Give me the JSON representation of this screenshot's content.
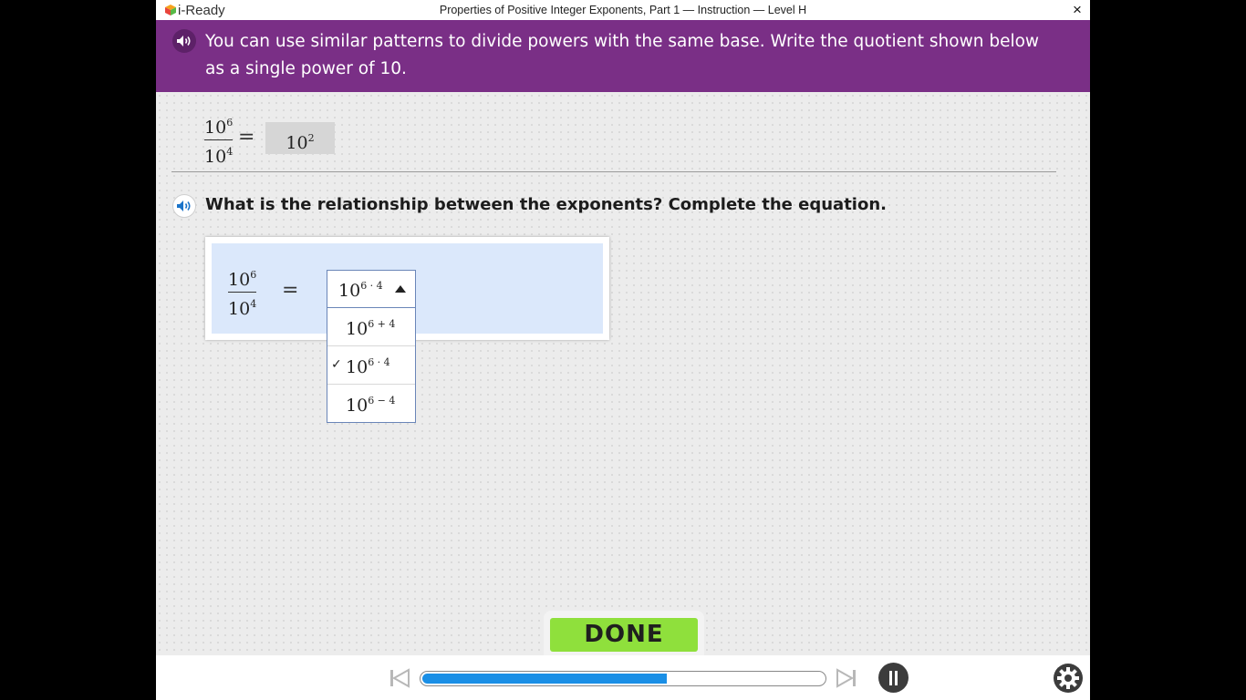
{
  "window": {
    "brand": "i-Ready",
    "title": "Properties of Positive Integer Exponents, Part 1 — Instruction — Level H",
    "close_label": "×"
  },
  "banner": {
    "text": "You can use similar patterns to divide powers with the same base. Write the quotient shown below as a single power of 10."
  },
  "example": {
    "num_base": "10",
    "num_exp": "6",
    "den_base": "10",
    "den_exp": "4",
    "equals": "=",
    "answer_base": "10",
    "answer_exp": "2"
  },
  "question": {
    "text": "What is the relationship between the exponents? Complete the equation."
  },
  "equation": {
    "num_base": "10",
    "num_exp": "6",
    "den_base": "10",
    "den_exp": "4",
    "equals": "="
  },
  "dropdown": {
    "selected_base": "10",
    "selected_exp": "6 · 4",
    "options": [
      {
        "base": "10",
        "exp": "6 + 4",
        "checked": false
      },
      {
        "base": "10",
        "exp": "6 · 4",
        "checked": true
      },
      {
        "base": "10",
        "exp": "6 − 4",
        "checked": false
      }
    ],
    "check_mark": "✓"
  },
  "done_label": "DONE",
  "progress": {
    "value": 0.61
  },
  "colors": {
    "banner": "#7a2f86",
    "done": "#8fe03c",
    "progress": "#1a8fe6",
    "answer_panel": "#dbe8fb"
  },
  "icons": [
    "speaker-icon",
    "skip-back-icon",
    "skip-forward-icon",
    "pause-icon",
    "gear-icon",
    "close-icon",
    "i-ready-logo-icon",
    "caret-up-icon",
    "check-icon"
  ]
}
